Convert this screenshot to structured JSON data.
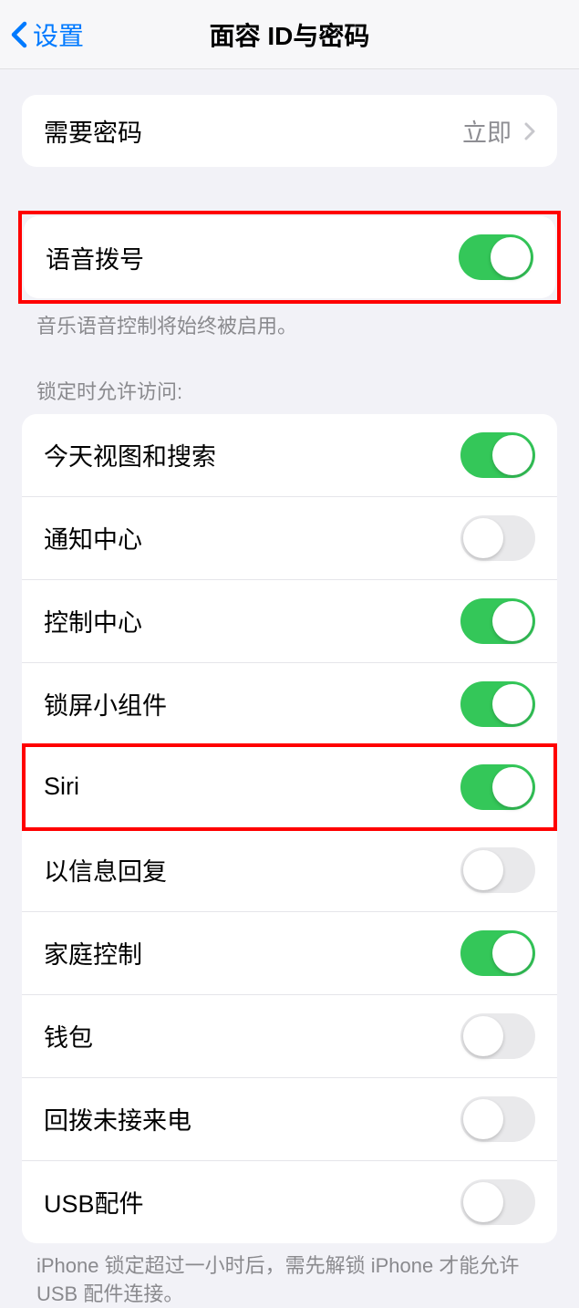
{
  "nav": {
    "back_label": "设置",
    "title": "面容 ID与密码"
  },
  "require_passcode": {
    "label": "需要密码",
    "value": "立即"
  },
  "voice_dial": {
    "label": "语音拨号",
    "on": true,
    "footer": "音乐语音控制将始终被启用。"
  },
  "lock_screen": {
    "header": "锁定时允许访问:",
    "items": [
      {
        "label": "今天视图和搜索",
        "on": true,
        "highlighted": false
      },
      {
        "label": "通知中心",
        "on": false,
        "highlighted": false
      },
      {
        "label": "控制中心",
        "on": true,
        "highlighted": false
      },
      {
        "label": "锁屏小组件",
        "on": true,
        "highlighted": false
      },
      {
        "label": "Siri",
        "on": true,
        "highlighted": true
      },
      {
        "label": "以信息回复",
        "on": false,
        "highlighted": false
      },
      {
        "label": "家庭控制",
        "on": true,
        "highlighted": false
      },
      {
        "label": "钱包",
        "on": false,
        "highlighted": false
      },
      {
        "label": "回拨未接来电",
        "on": false,
        "highlighted": false
      },
      {
        "label": "USB配件",
        "on": false,
        "highlighted": false
      }
    ],
    "footer": "iPhone 锁定超过一小时后，需先解锁 iPhone 才能允许 USB 配件连接。"
  }
}
